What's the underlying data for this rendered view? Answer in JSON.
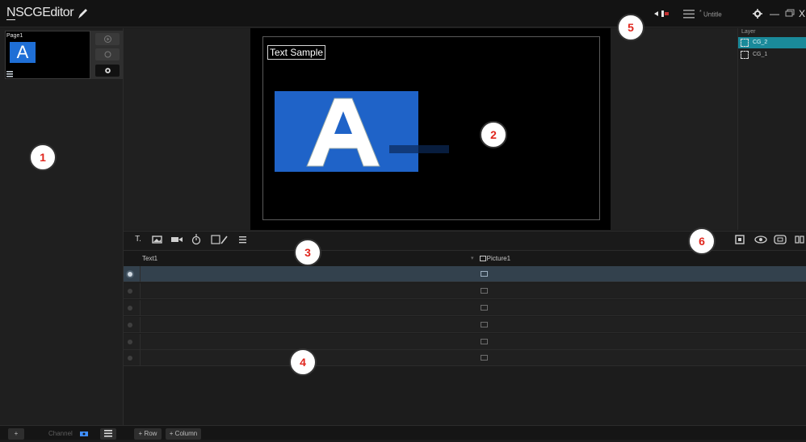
{
  "titlebar": {
    "app_title_prefix": "N",
    "app_title_rest": "SCGEditor",
    "project_name": "Untitle",
    "project_marker": "*",
    "icons": {
      "edit": "pencil-icon",
      "audio": "audio-speaker-icon",
      "menu": "menu-icon",
      "settings": "gear-icon",
      "minimize": "minimize-icon",
      "restore": "restore-icon",
      "close": "close-icon"
    },
    "minimize_glyph": "—",
    "close_glyph": "X"
  },
  "pages": {
    "page_label": "Page1",
    "thumb_letter": "A",
    "buttons": [
      "play-icon",
      "refresh-icon",
      "gear-icon"
    ]
  },
  "canvas": {
    "text_sample": "Text Sample",
    "big_letter": "A",
    "accent_color": "#1f63c8"
  },
  "layers": {
    "header": "Layer",
    "items": [
      {
        "name": "CG_2",
        "selected": true
      },
      {
        "name": "CG_1",
        "selected": false
      }
    ]
  },
  "toolbar": {
    "left_tools": [
      "text-tool-icon",
      "image-tool-icon",
      "video-tool-icon",
      "clock-tool-icon",
      "draw-tool-icon",
      "list-tool-icon"
    ],
    "right_tools": [
      "fit-view-icon",
      "eye-icon",
      "frame-icon",
      "grid-icon"
    ],
    "text_tool_glyph": "T."
  },
  "table": {
    "columns": [
      "Text1",
      "Picture1"
    ],
    "rows": [
      {
        "text1": "",
        "picture1": "",
        "selected": true
      },
      {
        "text1": "",
        "picture1": "",
        "selected": false
      },
      {
        "text1": "",
        "picture1": "",
        "selected": false
      },
      {
        "text1": "",
        "picture1": "",
        "selected": false
      },
      {
        "text1": "",
        "picture1": "",
        "selected": false
      },
      {
        "text1": "",
        "picture1": "",
        "selected": false
      }
    ]
  },
  "bottom": {
    "add_page": "+",
    "channel_label": "Channel",
    "add_row": "+ Row",
    "add_column": "+ Column"
  },
  "callouts": [
    "1",
    "2",
    "3",
    "4",
    "5",
    "6"
  ]
}
